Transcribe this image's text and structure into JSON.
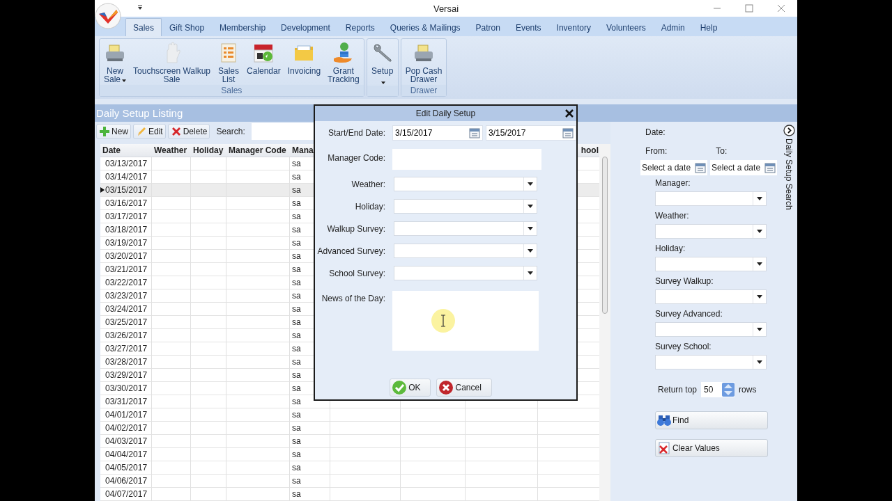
{
  "window": {
    "title": "Versai"
  },
  "ribbon_tabs": [
    {
      "label": "Sales",
      "selected": true
    },
    {
      "label": "Gift Shop",
      "selected": false
    },
    {
      "label": "Membership",
      "selected": false
    },
    {
      "label": "Development",
      "selected": false
    },
    {
      "label": "Reports",
      "selected": false
    },
    {
      "label": "Queries & Mailings",
      "selected": false
    },
    {
      "label": "Patron",
      "selected": false
    },
    {
      "label": "Events",
      "selected": false
    },
    {
      "label": "Inventory",
      "selected": false
    },
    {
      "label": "Volunteers",
      "selected": false
    },
    {
      "label": "Admin",
      "selected": false
    },
    {
      "label": "Help",
      "selected": false
    }
  ],
  "ribbon_groups": [
    {
      "label": "Sales",
      "items": [
        {
          "lines": [
            "New",
            "Sale"
          ],
          "kind": "register",
          "dropdown": true
        },
        {
          "lines": [
            "Touchscreen Walkup",
            "Sale"
          ],
          "kind": "hand",
          "dropdown": false
        },
        {
          "lines": [
            "Sales",
            "List"
          ],
          "kind": "list",
          "dropdown": false
        },
        {
          "lines": [
            "Calendar"
          ],
          "kind": "calendar",
          "dropdown": false
        },
        {
          "lines": [
            "Invoicing"
          ],
          "kind": "folder",
          "dropdown": false
        },
        {
          "lines": [
            "Grant",
            "Tracking"
          ],
          "kind": "money",
          "dropdown": false
        }
      ]
    },
    {
      "items": [
        {
          "lines": [
            "Setup"
          ],
          "kind": "wrench",
          "dropdown": true
        }
      ]
    },
    {
      "label": "Drawer",
      "items": [
        {
          "lines": [
            "Pop Cash",
            "Drawer"
          ],
          "kind": "register",
          "dropdown": false
        }
      ]
    }
  ],
  "listing": {
    "title": "Daily Setup Listing",
    "toolbar": [
      {
        "label": "New",
        "kind": "add"
      },
      {
        "label": "Edit",
        "kind": "edit"
      },
      {
        "label": "Delete",
        "kind": "delete"
      }
    ],
    "search_label": "Search:"
  },
  "grid": {
    "columns": [
      "Date",
      "Weather",
      "Holiday",
      "Manager Code",
      "Mana"
    ],
    "last_column": "hool",
    "rows": [
      {
        "date": "03/13/2017",
        "manager": "sa",
        "selected": false
      },
      {
        "date": "03/14/2017",
        "manager": "sa",
        "selected": false
      },
      {
        "date": "03/15/2017",
        "manager": "sa",
        "selected": true
      },
      {
        "date": "03/16/2017",
        "manager": "sa",
        "selected": false
      },
      {
        "date": "03/17/2017",
        "manager": "sa",
        "selected": false
      },
      {
        "date": "03/18/2017",
        "manager": "sa",
        "selected": false
      },
      {
        "date": "03/19/2017",
        "manager": "sa",
        "selected": false
      },
      {
        "date": "03/20/2017",
        "manager": "sa",
        "selected": false
      },
      {
        "date": "03/21/2017",
        "manager": "sa",
        "selected": false
      },
      {
        "date": "03/22/2017",
        "manager": "sa",
        "selected": false
      },
      {
        "date": "03/23/2017",
        "manager": "sa",
        "selected": false
      },
      {
        "date": "03/24/2017",
        "manager": "sa",
        "selected": false
      },
      {
        "date": "03/25/2017",
        "manager": "sa",
        "selected": false
      },
      {
        "date": "03/26/2017",
        "manager": "sa",
        "selected": false
      },
      {
        "date": "03/27/2017",
        "manager": "sa",
        "selected": false
      },
      {
        "date": "03/28/2017",
        "manager": "sa",
        "selected": false
      },
      {
        "date": "03/29/2017",
        "manager": "sa",
        "selected": false
      },
      {
        "date": "03/30/2017",
        "manager": "sa",
        "selected": false
      },
      {
        "date": "03/31/2017",
        "manager": "sa",
        "selected": false
      },
      {
        "date": "04/01/2017",
        "manager": "sa",
        "selected": false
      },
      {
        "date": "04/02/2017",
        "manager": "sa",
        "selected": false
      },
      {
        "date": "04/03/2017",
        "manager": "sa",
        "selected": false
      },
      {
        "date": "04/04/2017",
        "manager": "sa",
        "selected": false
      },
      {
        "date": "04/05/2017",
        "manager": "sa",
        "selected": false
      },
      {
        "date": "04/06/2017",
        "manager": "sa",
        "selected": false
      },
      {
        "date": "04/07/2017",
        "manager": "sa",
        "selected": false
      }
    ]
  },
  "dialog": {
    "title": "Edit Daily Setup",
    "date_label": "Start/End Date:",
    "start_date": "3/15/2017",
    "end_date": "3/15/2017",
    "fields": [
      {
        "label": "Manager Code:",
        "kind": "text"
      },
      {
        "label": "Weather:",
        "kind": "combo"
      },
      {
        "label": "Holiday:",
        "kind": "combo"
      },
      {
        "label": "Walkup Survey:",
        "kind": "combo"
      },
      {
        "label": "Advanced Survey:",
        "kind": "combo"
      },
      {
        "label": "School Survey:",
        "kind": "combo"
      },
      {
        "label": "News of the Day:",
        "kind": "memo"
      }
    ],
    "buttons": [
      {
        "label": "OK",
        "kind": "ok"
      },
      {
        "label": "Cancel",
        "kind": "cancel"
      }
    ]
  },
  "search_panel": {
    "title": "Daily Setup Search",
    "date_label": "Date:",
    "from_label": "From:",
    "to_label": "To:",
    "from": {
      "placeholder": "Select a date"
    },
    "to": {
      "placeholder": "Select a date"
    },
    "filters": [
      "Manager:",
      "Weather:",
      "Holiday:",
      "Survey Walkup:",
      "Survey Advanced:",
      "Survey School:"
    ],
    "return_label": "Return top",
    "return_value": "50",
    "rows_label": "rows",
    "buttons": [
      {
        "label": "Find",
        "kind": "find"
      },
      {
        "label": "Clear Values",
        "kind": "clear"
      }
    ]
  }
}
